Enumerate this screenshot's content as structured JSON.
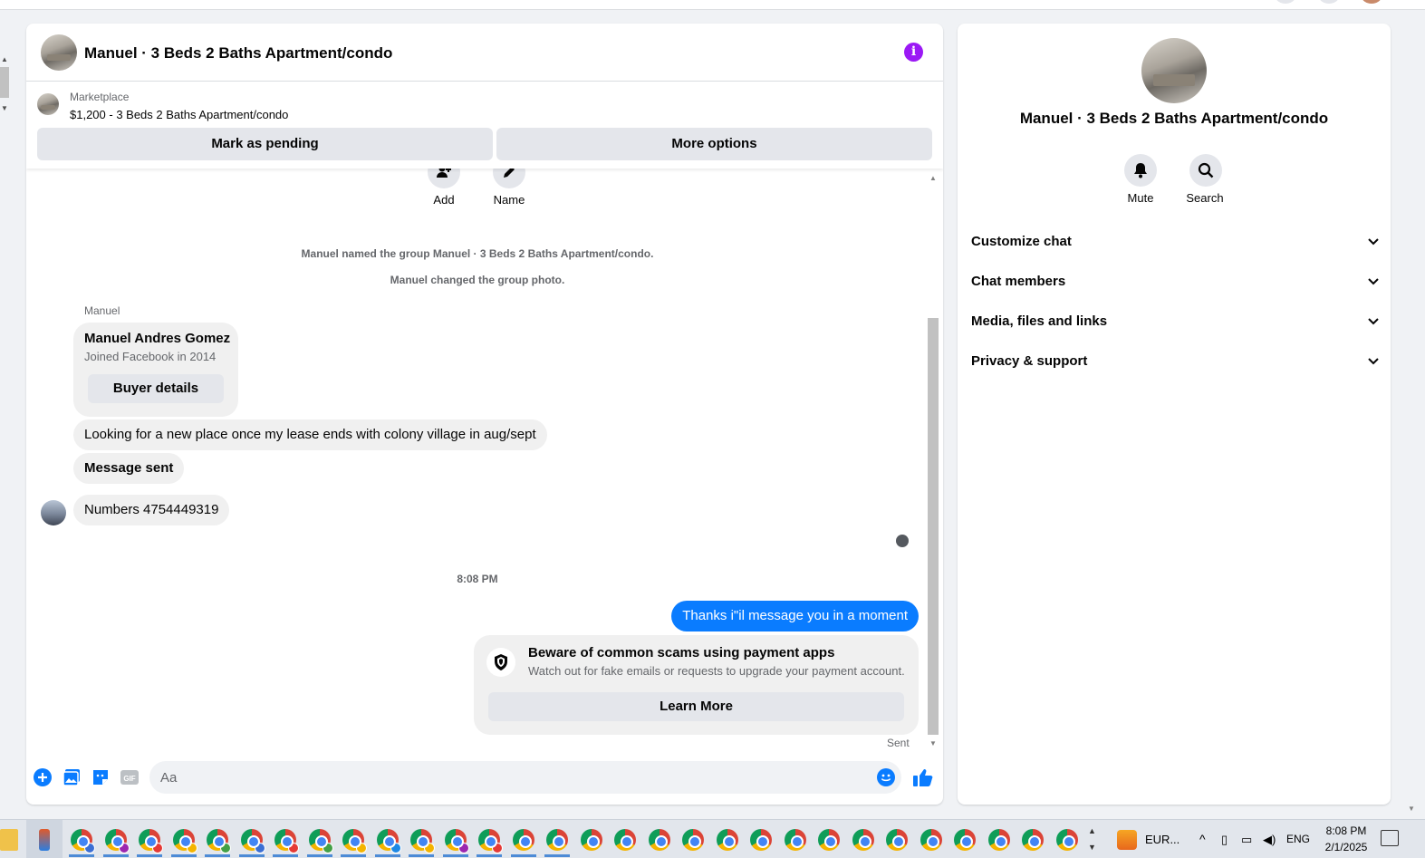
{
  "chat": {
    "title": "Manuel · 3 Beds 2 Baths Apartment/condo",
    "info_icon": "i",
    "marketplace": {
      "label": "Marketplace",
      "listing": "$1,200 - 3 Beds 2 Baths Apartment/condo"
    },
    "buttons": {
      "mark_pending": "Mark as pending",
      "more_options": "More options"
    },
    "actions": [
      {
        "label": "Add",
        "icon": "add-person-icon"
      },
      {
        "label": "Name",
        "icon": "pencil-icon"
      }
    ],
    "system_messages": [
      "Manuel named the group Manuel · 3 Beds 2 Baths Apartment/condo.",
      "Manuel changed the group photo."
    ],
    "sender_name": "Manuel",
    "buyer_card": {
      "name": "Manuel Andres Gomez",
      "joined": "Joined Facebook in 2014",
      "button": "Buyer details"
    },
    "incoming": [
      "Looking for a new place once my lease ends with colony village in aug/sept",
      "Message sent",
      "Numbers 4754449319"
    ],
    "timestamp": "8:08 PM",
    "outgoing": "Thanks i\"il message you in a moment",
    "scam_notice": {
      "title": "Beware of common scams using payment apps",
      "body": "Watch out for fake emails or requests to upgrade your payment account.",
      "button": "Learn More"
    },
    "status": "Sent",
    "composer": {
      "placeholder": "Aa",
      "icons": [
        "plus-circle-icon",
        "photo-icon",
        "sticker-icon",
        "gif-icon",
        "emoji-icon",
        "thumbs-up-icon"
      ]
    },
    "accent_color": "#0a7cff"
  },
  "details": {
    "title": "Manuel · 3 Beds 2 Baths Apartment/condo",
    "actions": [
      {
        "label": "Mute",
        "icon": "bell-icon"
      },
      {
        "label": "Search",
        "icon": "search-icon"
      }
    ],
    "sections": [
      "Customize chat",
      "Chat members",
      "Media, files and links",
      "Privacy & support"
    ]
  },
  "taskbar": {
    "currency": "EUR...",
    "language": "ENG",
    "time": "8:08 PM",
    "date": "2/1/2025"
  }
}
